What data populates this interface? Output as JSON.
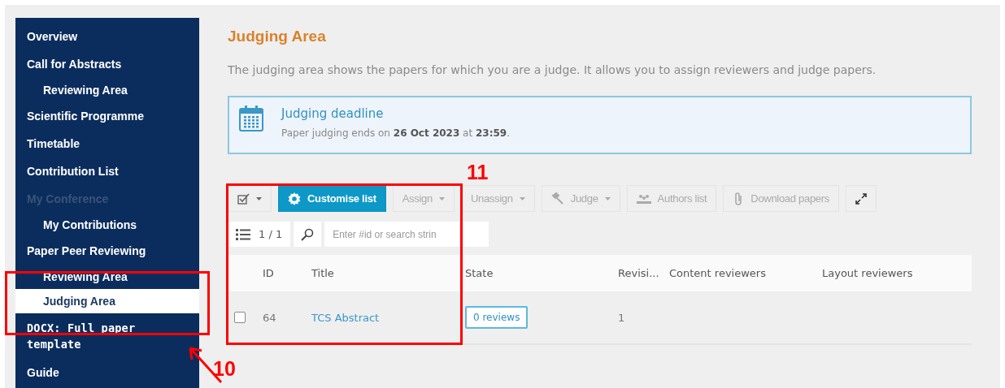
{
  "sidebar": {
    "items": [
      {
        "label": "Overview",
        "selected": false,
        "disabled": false
      },
      {
        "label": "Call for Abstracts",
        "selected": false,
        "disabled": false,
        "children": [
          {
            "label": "Reviewing Area",
            "selected": false,
            "disabled": false
          }
        ]
      },
      {
        "label": "Scientific Programme",
        "selected": false,
        "disabled": false
      },
      {
        "label": "Timetable",
        "selected": false,
        "disabled": false
      },
      {
        "label": "Contribution List",
        "selected": false,
        "disabled": false
      },
      {
        "label": "My Conference",
        "selected": false,
        "disabled": true,
        "children": [
          {
            "label": "My Contributions",
            "selected": false,
            "disabled": false
          }
        ]
      },
      {
        "label": "Paper Peer Reviewing",
        "selected": false,
        "disabled": false,
        "children": [
          {
            "label": "Reviewing Area",
            "selected": false,
            "disabled": false
          },
          {
            "label": "Judging Area",
            "selected": true,
            "disabled": false
          }
        ]
      },
      {
        "label": "DOCX: Full paper template",
        "selected": false,
        "disabled": false,
        "kind": "file"
      },
      {
        "label": "Guide",
        "selected": false,
        "disabled": false
      }
    ]
  },
  "page": {
    "title": "Judging Area",
    "description": "The judging area shows the papers for which you are a judge. It allows you to assign reviewers and judge papers."
  },
  "deadline": {
    "title": "Judging deadline",
    "text": "Paper judging ends on **26 Oct 2023** at **23:59**."
  },
  "toolbar": {
    "buttons": [
      {
        "label": "Customise list",
        "kind": "primary",
        "caret": false,
        "disabled": false
      },
      {
        "label": "Assign",
        "kind": "plain",
        "caret": true,
        "disabled": true
      },
      {
        "label": "Unassign",
        "kind": "plain",
        "caret": true,
        "disabled": true
      },
      {
        "label": "Judge",
        "kind": "plain",
        "caret": true,
        "disabled": true
      },
      {
        "label": "Authors list",
        "kind": "plain",
        "caret": false,
        "disabled": true
      },
      {
        "label": "Download papers",
        "kind": "plain",
        "caret": false,
        "disabled": true
      }
    ]
  },
  "filter": {
    "count": "1 / 1",
    "search": {
      "placeholder": "Enter #id or search strin"
    }
  },
  "table": {
    "columns": [
      "ID",
      "Title",
      "State",
      "Revisi...",
      "Content reviewers",
      "Layout reviewers"
    ],
    "rows": [
      {
        "checked": false,
        "id": "64",
        "title": "TCS Abstract",
        "state": "0 reviews",
        "revision": "1"
      }
    ]
  },
  "annotations": [
    {
      "label": "11"
    },
    {
      "label": "10"
    }
  ]
}
